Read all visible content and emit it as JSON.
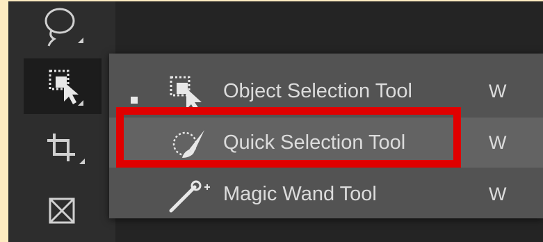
{
  "toolbar": {
    "tools": [
      {
        "name": "lasso-tool",
        "icon": "lasso-icon"
      },
      {
        "name": "object-selection-tool",
        "icon": "object-selection-icon",
        "active": true
      },
      {
        "name": "crop-tool",
        "icon": "crop-icon"
      },
      {
        "name": "frame-tool",
        "icon": "frame-icon"
      }
    ]
  },
  "flyout": {
    "items": [
      {
        "label": "Object Selection Tool",
        "shortcut": "W",
        "icon": "object-selection-icon",
        "selected": true
      },
      {
        "label": "Quick Selection Tool",
        "shortcut": "W",
        "icon": "quick-selection-icon",
        "hovered": true
      },
      {
        "label": "Magic Wand Tool",
        "shortcut": "W",
        "icon": "magic-wand-icon"
      }
    ]
  },
  "colors": {
    "highlight": "#e00000",
    "panel": "#535353",
    "hover": "#636363",
    "background": "#fdebc0"
  }
}
